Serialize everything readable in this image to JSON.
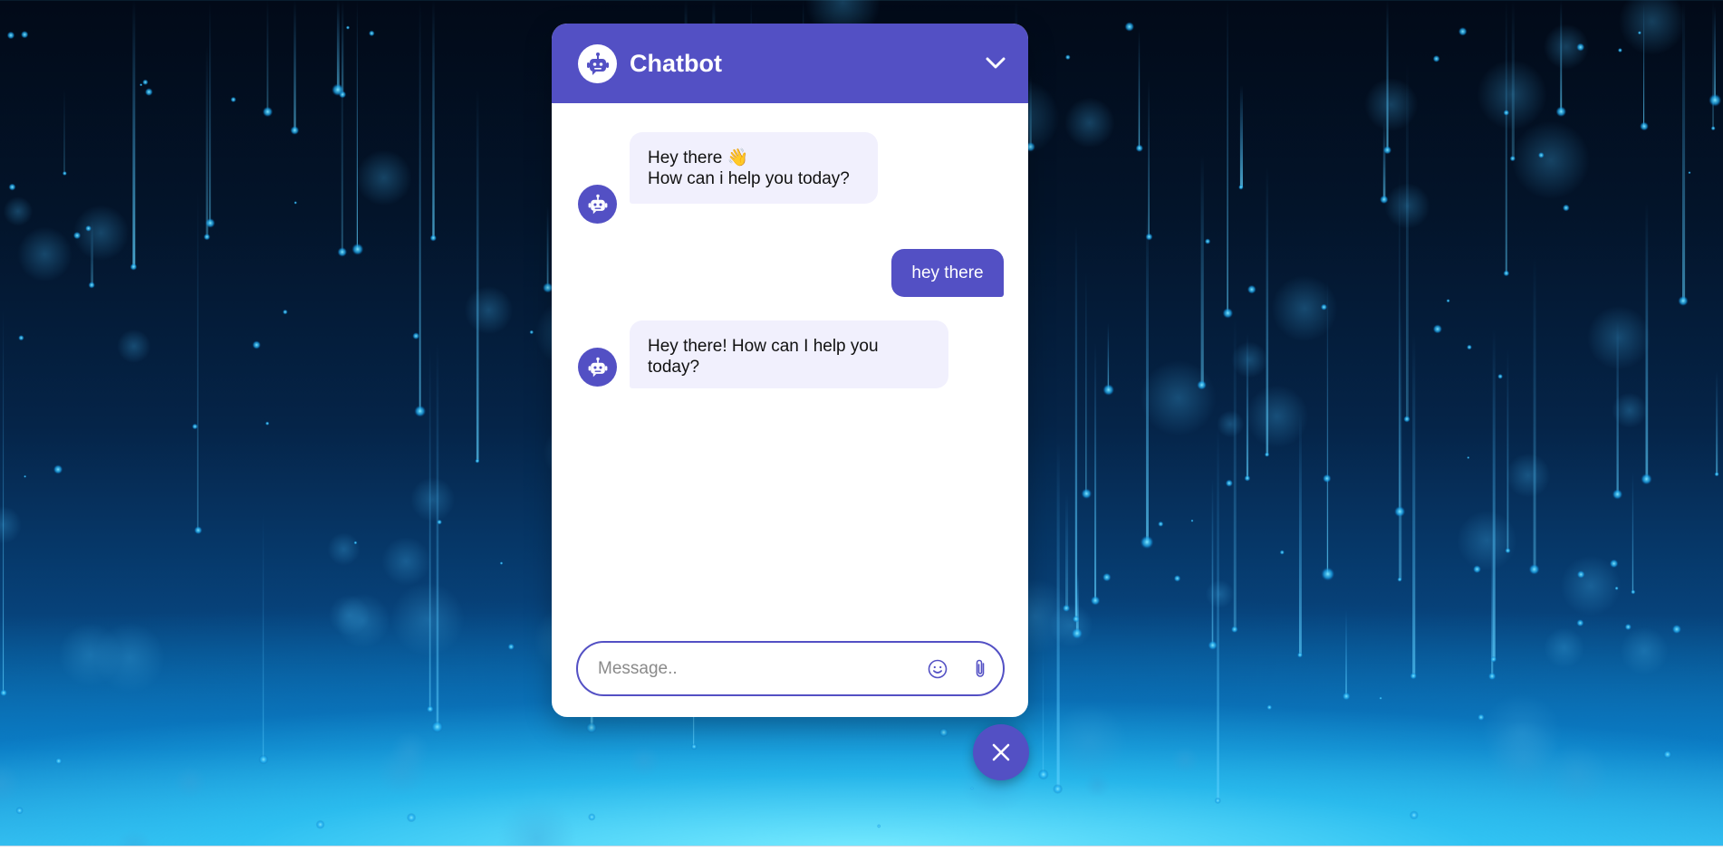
{
  "chatbot": {
    "title": "Chatbot",
    "header_icon": "robot-icon",
    "toggle_icon": "chevron-down-icon"
  },
  "messages": [
    {
      "role": "bot",
      "line1": "Hey there 👋",
      "line2": "How can i help you today?"
    },
    {
      "role": "user",
      "text": "hey there"
    },
    {
      "role": "bot",
      "line1": "Hey there! How can I help you",
      "line2": "today?"
    }
  ],
  "composer": {
    "placeholder": "Message..",
    "emoji_icon": "smiley-icon",
    "attach_icon": "paperclip-icon"
  },
  "launcher": {
    "icon": "close-icon"
  },
  "colors": {
    "accent": "#5350c4",
    "bot_bubble": "#f1f0fd",
    "background_top": "#020a18",
    "background_bottom": "#4fd8ff"
  }
}
